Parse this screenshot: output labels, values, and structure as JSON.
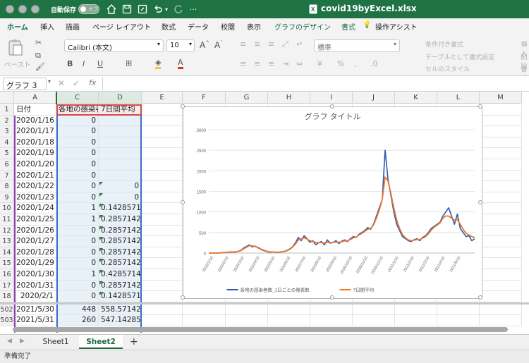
{
  "titlebar": {
    "autosave_label": "自動保存",
    "autosave_state": "オフ",
    "filename": "covid19byExcel.xlsx",
    "accent": "#1f7244"
  },
  "ribbon_tabs": [
    {
      "label": "ホーム",
      "active": true
    },
    {
      "label": "挿入"
    },
    {
      "label": "描画"
    },
    {
      "label": "ページ レイアウト"
    },
    {
      "label": "数式"
    },
    {
      "label": "データ"
    },
    {
      "label": "校閲"
    },
    {
      "label": "表示"
    },
    {
      "label": "グラフのデザイン",
      "contextual": true
    },
    {
      "label": "書式",
      "contextual": true
    },
    {
      "label": "操作アシスト"
    }
  ],
  "ribbon": {
    "paste_label": "ペースト",
    "font_name": "Calibri (本文)",
    "font_size": "10",
    "number_format": "標準",
    "conditional_format": "条件付き書式",
    "format_as_table": "テーブルとして書式設定",
    "cell_styles": "セルのスタイル",
    "insert_label": "挿入",
    "delete_label": "削除",
    "format_label": "書式"
  },
  "formula_bar": {
    "name_box": "グラフ 3",
    "fx": "fx"
  },
  "grid": {
    "columns": [
      "A",
      "C",
      "D",
      "E",
      "F",
      "G",
      "H",
      "I",
      "J",
      "K",
      "L",
      "M"
    ],
    "header_row": {
      "num": "1",
      "A": "日付",
      "C": "各地の感染者",
      "D": "7日間平均"
    },
    "rows": [
      {
        "num": "2",
        "date": "2020/1/16",
        "cases": "0",
        "avg": ""
      },
      {
        "num": "3",
        "date": "2020/1/17",
        "cases": "0",
        "avg": ""
      },
      {
        "num": "4",
        "date": "2020/1/18",
        "cases": "0",
        "avg": ""
      },
      {
        "num": "5",
        "date": "2020/1/19",
        "cases": "0",
        "avg": ""
      },
      {
        "num": "6",
        "date": "2020/1/20",
        "cases": "0",
        "avg": ""
      },
      {
        "num": "7",
        "date": "2020/1/21",
        "cases": "0",
        "avg": ""
      },
      {
        "num": "8",
        "date": "2020/1/22",
        "cases": "0",
        "avg": "0"
      },
      {
        "num": "9",
        "date": "2020/1/23",
        "cases": "0",
        "avg": "0"
      },
      {
        "num": "10",
        "date": "2020/1/24",
        "cases": "1",
        "avg": "0.14285714"
      },
      {
        "num": "11",
        "date": "2020/1/25",
        "cases": "1",
        "avg": "0.28571429"
      },
      {
        "num": "12",
        "date": "2020/1/26",
        "cases": "0",
        "avg": "0.28571429"
      },
      {
        "num": "13",
        "date": "2020/1/27",
        "cases": "0",
        "avg": "0.28571429"
      },
      {
        "num": "14",
        "date": "2020/1/28",
        "cases": "0",
        "avg": "0.28571429"
      },
      {
        "num": "15",
        "date": "2020/1/29",
        "cases": "0",
        "avg": "0.28571429"
      },
      {
        "num": "16",
        "date": "2020/1/30",
        "cases": "1",
        "avg": "0.42857143"
      },
      {
        "num": "17",
        "date": "2020/1/31",
        "cases": "0",
        "avg": "0.28571429"
      },
      {
        "num": "18",
        "date": "2020/2/1",
        "cases": "0",
        "avg": "0.14285714"
      },
      {
        "num": "502",
        "date": "2021/5/30",
        "cases": "448",
        "avg": "558.571429"
      },
      {
        "num": "503",
        "date": "2021/5/31",
        "cases": "260",
        "avg": "547.142857"
      }
    ]
  },
  "chart_data": {
    "type": "line",
    "title": "グラフ タイトル",
    "ylim": [
      0,
      3000
    ],
    "yticks": [
      "0",
      "500",
      "1000",
      "1500",
      "2000",
      "2500",
      "3000"
    ],
    "x_ticks": [
      "2020/1/16",
      "2020/2/16",
      "2020/3/16",
      "2020/4/16",
      "2020/5/16",
      "2020/6/16",
      "2020/7/16",
      "2020/8/16",
      "2020/9/16",
      "2020/10/16",
      "2020/11/16",
      "2020/12/16",
      "2021/1/16",
      "2021/2/16",
      "2021/3/16",
      "2021/4/16",
      "2021/5/16"
    ],
    "grid": true,
    "legend_position": "bottom",
    "series": [
      {
        "name": "各地の感染者数_1日ごとの発表数",
        "color": "#2a5caa",
        "values": [
          0,
          0,
          0,
          0,
          5,
          10,
          15,
          25,
          30,
          20,
          40,
          60,
          120,
          160,
          200,
          150,
          170,
          130,
          90,
          60,
          40,
          20,
          30,
          20,
          15,
          30,
          40,
          60,
          100,
          150,
          250,
          380,
          300,
          420,
          350,
          260,
          300,
          200,
          250,
          280,
          200,
          320,
          240,
          260,
          300,
          230,
          290,
          320,
          280,
          350,
          400,
          380,
          460,
          500,
          550,
          620,
          580,
          700,
          900,
          1100,
          1300,
          2500,
          1800,
          1400,
          1000,
          700,
          550,
          400,
          350,
          300,
          280,
          320,
          350,
          300,
          380,
          420,
          500,
          600,
          650,
          700,
          750,
          900,
          1000,
          1100,
          900,
          700,
          950,
          600,
          500,
          400,
          420,
          300,
          350
        ]
      },
      {
        "name": "7日間平均",
        "color": "#e9772f",
        "values": [
          0,
          0,
          0,
          0,
          3,
          8,
          12,
          20,
          26,
          28,
          35,
          55,
          100,
          140,
          180,
          175,
          160,
          140,
          100,
          70,
          45,
          30,
          25,
          22,
          20,
          25,
          35,
          55,
          90,
          140,
          220,
          320,
          340,
          370,
          340,
          300,
          280,
          260,
          250,
          255,
          240,
          260,
          255,
          260,
          270,
          260,
          275,
          295,
          300,
          330,
          370,
          390,
          440,
          480,
          530,
          580,
          600,
          680,
          850,
          1050,
          1300,
          1850,
          1750,
          1450,
          1100,
          800,
          600,
          450,
          370,
          320,
          300,
          310,
          330,
          330,
          360,
          400,
          470,
          560,
          630,
          680,
          730,
          850,
          900,
          900,
          850,
          800,
          820,
          700,
          580,
          480,
          440,
          400,
          380
        ]
      }
    ]
  },
  "sheet_tabs": [
    {
      "label": "Sheet1"
    },
    {
      "label": "Sheet2",
      "active": true
    }
  ],
  "status": {
    "text": "準備完了"
  }
}
